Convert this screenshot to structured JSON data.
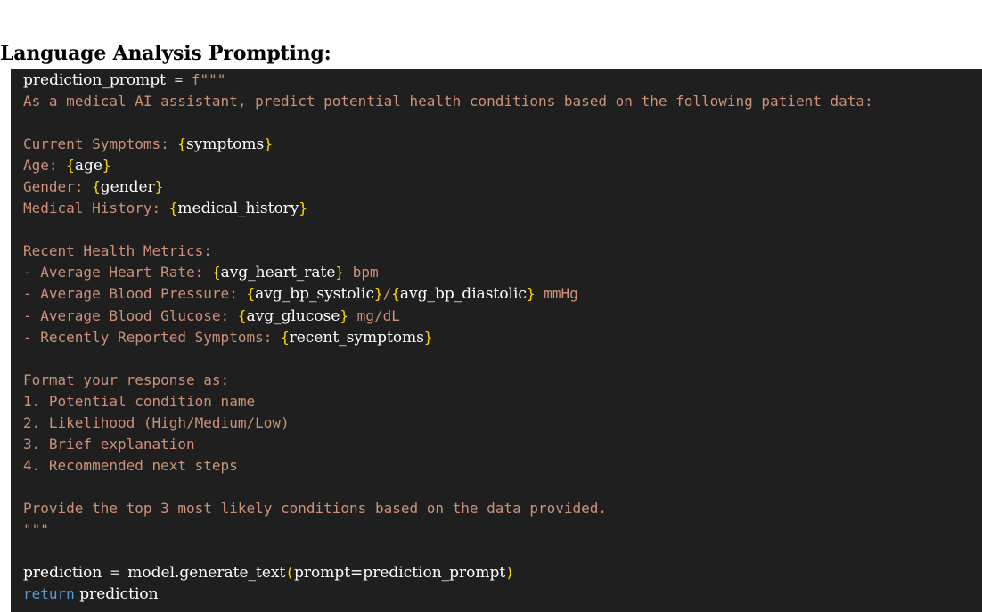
{
  "heading": "Language Analysis Prompting:",
  "code": {
    "line1": {
      "name": "prediction_prompt",
      "eq": " = ",
      "fprefix": "f\"\"\""
    },
    "line2": "As a medical AI assistant, predict potential health conditions based on the following patient data:",
    "line4": {
      "label": "Current Symptoms: ",
      "var": "symptoms"
    },
    "line5": {
      "label": "Age: ",
      "var": "age"
    },
    "line6": {
      "label": "Gender: ",
      "var": "gender"
    },
    "line7": {
      "label": "Medical History: ",
      "var": "medical_history"
    },
    "line9": "Recent Health Metrics:",
    "line10": {
      "label": "- Average Heart Rate: ",
      "var": "avg_heart_rate",
      "suffix": " bpm"
    },
    "line11": {
      "label": "- Average Blood Pressure: ",
      "var1": "avg_bp_systolic",
      "sep": "/",
      "var2": "avg_bp_diastolic",
      "suffix": " mmHg"
    },
    "line12": {
      "label": "- Average Blood Glucose: ",
      "var": "avg_glucose",
      "suffix": " mg/dL"
    },
    "line13": {
      "label": "- Recently Reported Symptoms: ",
      "var": "recent_symptoms"
    },
    "line15": "Format your response as:",
    "line16": "1. Potential condition name",
    "line17": "2. Likelihood (High/Medium/Low)",
    "line18": "3. Brief explanation",
    "line19": "4. Recommended next steps",
    "line21": "Provide the top 3 most likely conditions based on the data provided.",
    "line22": "\"\"\"",
    "line24": {
      "lhs": "prediction",
      "eq": " = ",
      "call": "model.generate_text",
      "open": "(",
      "arg": "prompt=prediction_prompt",
      "close": ")"
    },
    "line25": {
      "kw": "return",
      "val": " prediction"
    }
  },
  "colors": {
    "code_background": "#1f1f1f",
    "string": "#ce9178",
    "brace": "#ffd700",
    "keyword": "#569cd6",
    "identifier": "#ffffff"
  }
}
